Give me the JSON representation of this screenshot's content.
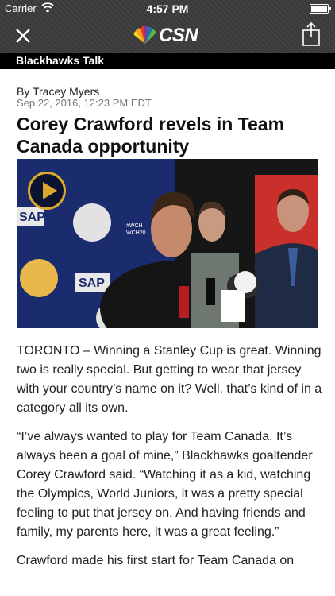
{
  "status_bar": {
    "carrier": "Carrier",
    "time": "4:57 PM"
  },
  "nav": {
    "logo_text": "CSN",
    "close_icon": "close-icon",
    "share_icon": "share-icon"
  },
  "section": {
    "label": "Blackhawks Talk"
  },
  "article": {
    "byline": "By Tracey Myers",
    "date": "Sep 22, 2016, 12:23 PM EDT",
    "headline": "Corey Crawford revels in Team Canada opportunity",
    "paragraphs": [
      "TORONTO – Winning a Stanley Cup is great. Winning two is really special. But getting to wear that jersey with your country’s name on it? Well, that’s kind of in a category all its own.",
      "“I’ve always wanted to play for Team Canada. It’s always been a goal of mine,” Blackhawks goaltender Corey Crawford said. “Watching it as a kid, watching the Olympics, World Juniors, it was a pretty special feeling to put that jersey on. And having friends and family, my parents here, it was a great feeling.”",
      "Crawford made his first start for Team Canada on"
    ]
  },
  "photo": {
    "backdrop_text": [
      "SAP",
      "SAP",
      "#WCH",
      "WCH20"
    ],
    "accent_colors": {
      "backdrop": "#1a2c6e",
      "play_ring": "#d9a92c"
    }
  }
}
